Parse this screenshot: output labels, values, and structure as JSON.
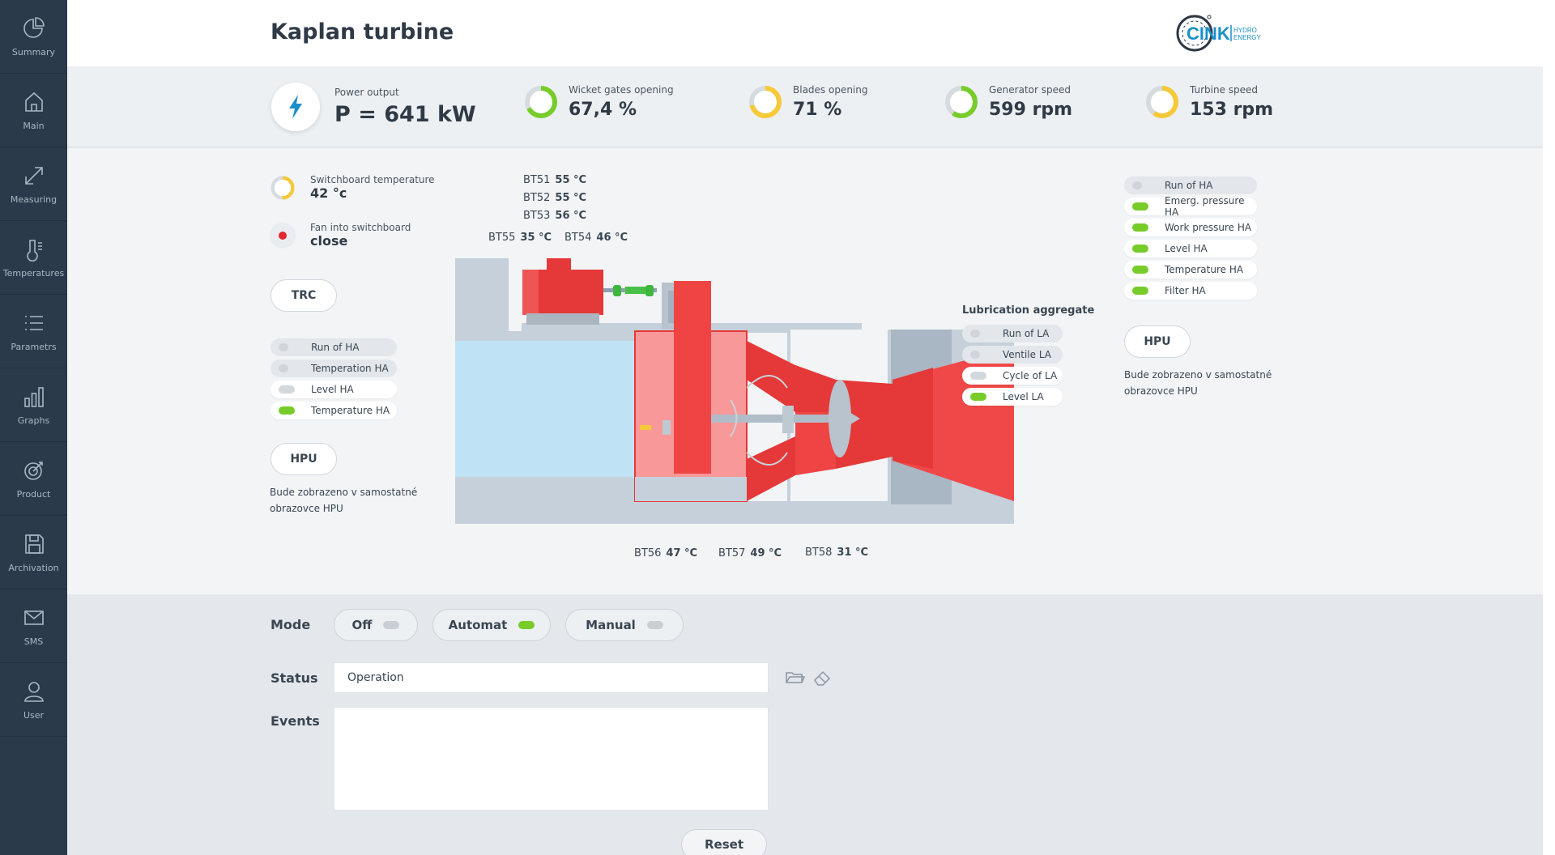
{
  "sidebar": {
    "items": [
      {
        "label": "Summary",
        "icon": "pie-chart-icon"
      },
      {
        "label": "Main",
        "icon": "home-icon"
      },
      {
        "label": "Measuring",
        "icon": "expand-icon"
      },
      {
        "label": "Temperatures",
        "icon": "thermometer-icon"
      },
      {
        "label": "Parametrs",
        "icon": "list-icon"
      },
      {
        "label": "Graphs",
        "icon": "bar-chart-icon"
      },
      {
        "label": "Product",
        "icon": "target-icon"
      },
      {
        "label": "Archivation",
        "icon": "archive-icon"
      },
      {
        "label": "SMS",
        "icon": "mail-icon"
      },
      {
        "label": "User",
        "icon": "user-icon"
      }
    ]
  },
  "header": {
    "title": "Kaplan turbine",
    "logo_text": "CINK",
    "logo_sub1": "HYDRO",
    "logo_sub2": "ENERGY"
  },
  "metrics": {
    "power": {
      "label": "Power output",
      "value": "P = 641 kW"
    },
    "wicket": {
      "label": "Wicket gates opening",
      "value": "67,4 %",
      "fill": 0.674,
      "color": "#77cc2a"
    },
    "blades": {
      "label": "Blades opening",
      "value": "71 %",
      "fill": 0.71,
      "color": "#f5c938"
    },
    "generator": {
      "label": "Generator speed",
      "value": "599 rpm",
      "fill": 0.6,
      "color": "#77cc2a"
    },
    "turbine": {
      "label": "Turbine speed",
      "value": "153 rpm",
      "fill": 0.6,
      "color": "#f5c938"
    }
  },
  "left_panel": {
    "switchboard_temp": {
      "label": "Switchboard temperature",
      "value": "42 °c",
      "fill": 0.5,
      "color": "#f5c938"
    },
    "fan": {
      "label": "Fan into switchboard",
      "value": "close"
    },
    "trc_label": "TRC",
    "status": [
      {
        "label": "Run of HA",
        "state": "grey"
      },
      {
        "label": "Temperation HA",
        "state": "grey"
      },
      {
        "label": "Level HA",
        "state": "lgrey"
      },
      {
        "label": "Temperature HA",
        "state": "green"
      }
    ],
    "hpu_label": "HPU",
    "note": "Bude zobrazeno v samostatné obrazovce HPU"
  },
  "sensors": {
    "bt51": {
      "name": "BT51",
      "value": "55 °C"
    },
    "bt52": {
      "name": "BT52",
      "value": "55 °C"
    },
    "bt53": {
      "name": "BT53",
      "value": "56 °C"
    },
    "bt55": {
      "name": "BT55",
      "value": "35 °C"
    },
    "bt54": {
      "name": "BT54",
      "value": "46 °C"
    },
    "bt56": {
      "name": "BT56",
      "value": "47 °C"
    },
    "bt57": {
      "name": "BT57",
      "value": "49 °C"
    },
    "bt58": {
      "name": "BT58",
      "value": "31 °C"
    }
  },
  "lubrication": {
    "title": "Lubrication aggregate",
    "status": [
      {
        "label": "Run of LA",
        "state": "grey"
      },
      {
        "label": "Ventile LA",
        "state": "grey"
      },
      {
        "label": "Cycle of LA",
        "state": "lgrey"
      },
      {
        "label": "Level LA",
        "state": "green"
      }
    ]
  },
  "right_panel": {
    "status": [
      {
        "label": "Run of HA",
        "state": "grey"
      },
      {
        "label": "Emerg. pressure HA",
        "state": "green"
      },
      {
        "label": "Work pressure HA",
        "state": "green"
      },
      {
        "label": "Level HA",
        "state": "green"
      },
      {
        "label": "Temperature HA",
        "state": "green"
      },
      {
        "label": "Filter HA",
        "state": "green"
      }
    ],
    "hpu_label": "HPU",
    "note": "Bude zobrazeno v samostatné obrazovce HPU"
  },
  "controls": {
    "mode_label": "Mode",
    "modes": [
      {
        "label": "Off",
        "active": false
      },
      {
        "label": "Automat",
        "active": true
      },
      {
        "label": "Manual",
        "active": false
      }
    ],
    "status_label": "Status",
    "status_value": "Operation",
    "events_label": "Events",
    "events_value": "",
    "reset_label": "Reset"
  },
  "colors": {
    "sidebar": "#2b3a4a",
    "accent_green": "#77cc2a",
    "accent_yellow": "#f5c938",
    "alarm_red": "#e22630",
    "machine_red": "#f04848",
    "water": "#bfe3f5"
  }
}
